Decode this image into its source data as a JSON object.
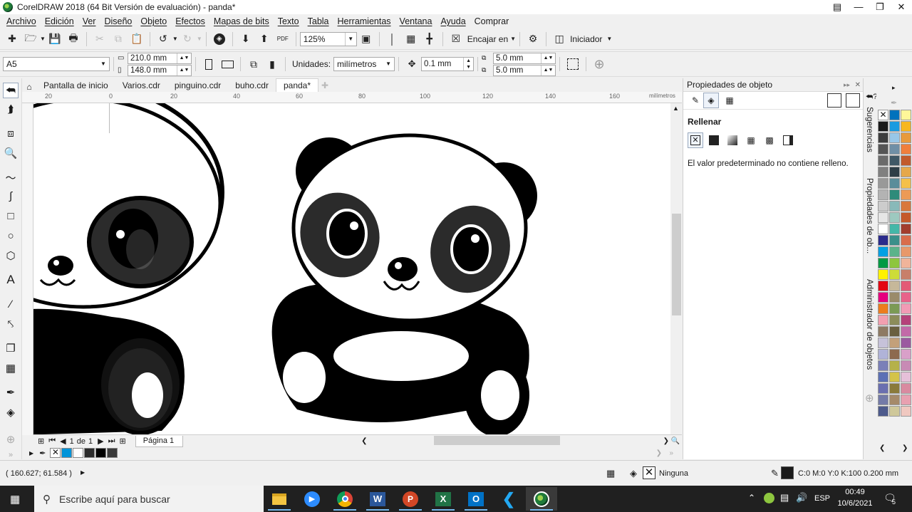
{
  "window": {
    "title": "CorelDRAW 2018 (64 Bit Versión de evaluación) - panda*"
  },
  "menu": [
    "Archivo",
    "Edición",
    "Ver",
    "Diseño",
    "Objeto",
    "Efectos",
    "Mapas de bits",
    "Texto",
    "Tabla",
    "Herramientas",
    "Ventana",
    "Ayuda",
    "Comprar"
  ],
  "toolbar1": {
    "zoom": "125%",
    "fit_label": "Encajar en",
    "launcher_label": "Iniciador"
  },
  "toolbar2": {
    "page_size": "A5",
    "width": "210.0 mm",
    "height": "148.0 mm",
    "units_label": "Unidades:",
    "units_value": "milímetros",
    "nudge": "0.1 mm",
    "dup_x": "5.0 mm",
    "dup_y": "5.0 mm"
  },
  "tabs": {
    "welcome": "Pantalla de inicio",
    "items": [
      "Varios.cdr",
      "pinguino.cdr",
      "buho.cdr",
      "panda*"
    ]
  },
  "ruler": {
    "top": [
      "20",
      "0",
      "20",
      "40",
      "60",
      "80",
      "100",
      "120",
      "140",
      "160"
    ],
    "unit": "milímetros"
  },
  "pagenav": {
    "current": "1",
    "of": "de",
    "total": "1",
    "page_tab": "Página 1"
  },
  "docker": {
    "title": "Propiedades de objeto",
    "section": "Rellenar",
    "message": "El valor predeterminado no contiene relleno.",
    "vtabs": [
      "Sugerencias",
      "Propiedades de ob...",
      "Administrador de objetos"
    ]
  },
  "statusbar": {
    "coords": "( 160.627; 61.584 )",
    "fill_label": "Ninguna",
    "outline_label": "C:0 M:0 Y:0 K:100  0.200 mm"
  },
  "taskbar": {
    "search_placeholder": "Escribe aquí para buscar",
    "lang": "ESP",
    "time": "00:49",
    "date": "10/6/2021",
    "notif_count": "5"
  },
  "colors": {
    "selection": "#9aa9bd",
    "taskbar": "#202020",
    "palette_col1": [
      "#ffffff",
      "#1a1a1a",
      "#3d3d3d",
      "#555555",
      "#6b6b6b",
      "#808080",
      "#999999",
      "#b3b3b3",
      "#cccccc",
      "#e6e6e6",
      "#ffffff",
      "#2b2b8c",
      "#00a0e3",
      "#009a44",
      "#fff200",
      "#e30613",
      "#e6007e",
      "#ec7d1e",
      "#f29fb0",
      "#8e7a63",
      "#c6c2d9",
      "#b0b3d8",
      "#7a7fb8",
      "#5c70b5",
      "#6a6fb0",
      "#737aa8",
      "#4d5a8c"
    ],
    "palette_col2": [
      "#0072bc",
      "#1a9be0",
      "#98c7e8",
      "#6f8fa6",
      "#3f5866",
      "#2e3e47",
      "#5a8d9a",
      "#2f8b7a",
      "#89b9b9",
      "#9dc9c0",
      "#44b7a8",
      "#3a8f8a",
      "#5bb38a",
      "#8dc63f",
      "#cddc39",
      "#c6b89a",
      "#9a8b6a",
      "#7b9a55",
      "#8c8c5a",
      "#6a5f3f",
      "#c3a07a",
      "#8d6a4f",
      "#b5b14a",
      "#d4c34a",
      "#8a7a3a",
      "#a58a6a",
      "#cfc89a"
    ],
    "palette_col3": [
      "#fff799",
      "#f7b71f",
      "#e89a3c",
      "#f07f3c",
      "#c25b2c",
      "#e6a84a",
      "#f4c04a",
      "#ec9a56",
      "#d9783b",
      "#c55a2b",
      "#a33d2d",
      "#d96c4b",
      "#e8986a",
      "#f0b49a",
      "#c87f6a",
      "#e35a76",
      "#e8638a",
      "#f19bb5",
      "#b5427a",
      "#c26aa8",
      "#9b5aa0",
      "#d9a0c9",
      "#c88ab5",
      "#e6c0d9",
      "#d98aa0",
      "#e8a0b0",
      "#f0c8c0"
    ]
  }
}
